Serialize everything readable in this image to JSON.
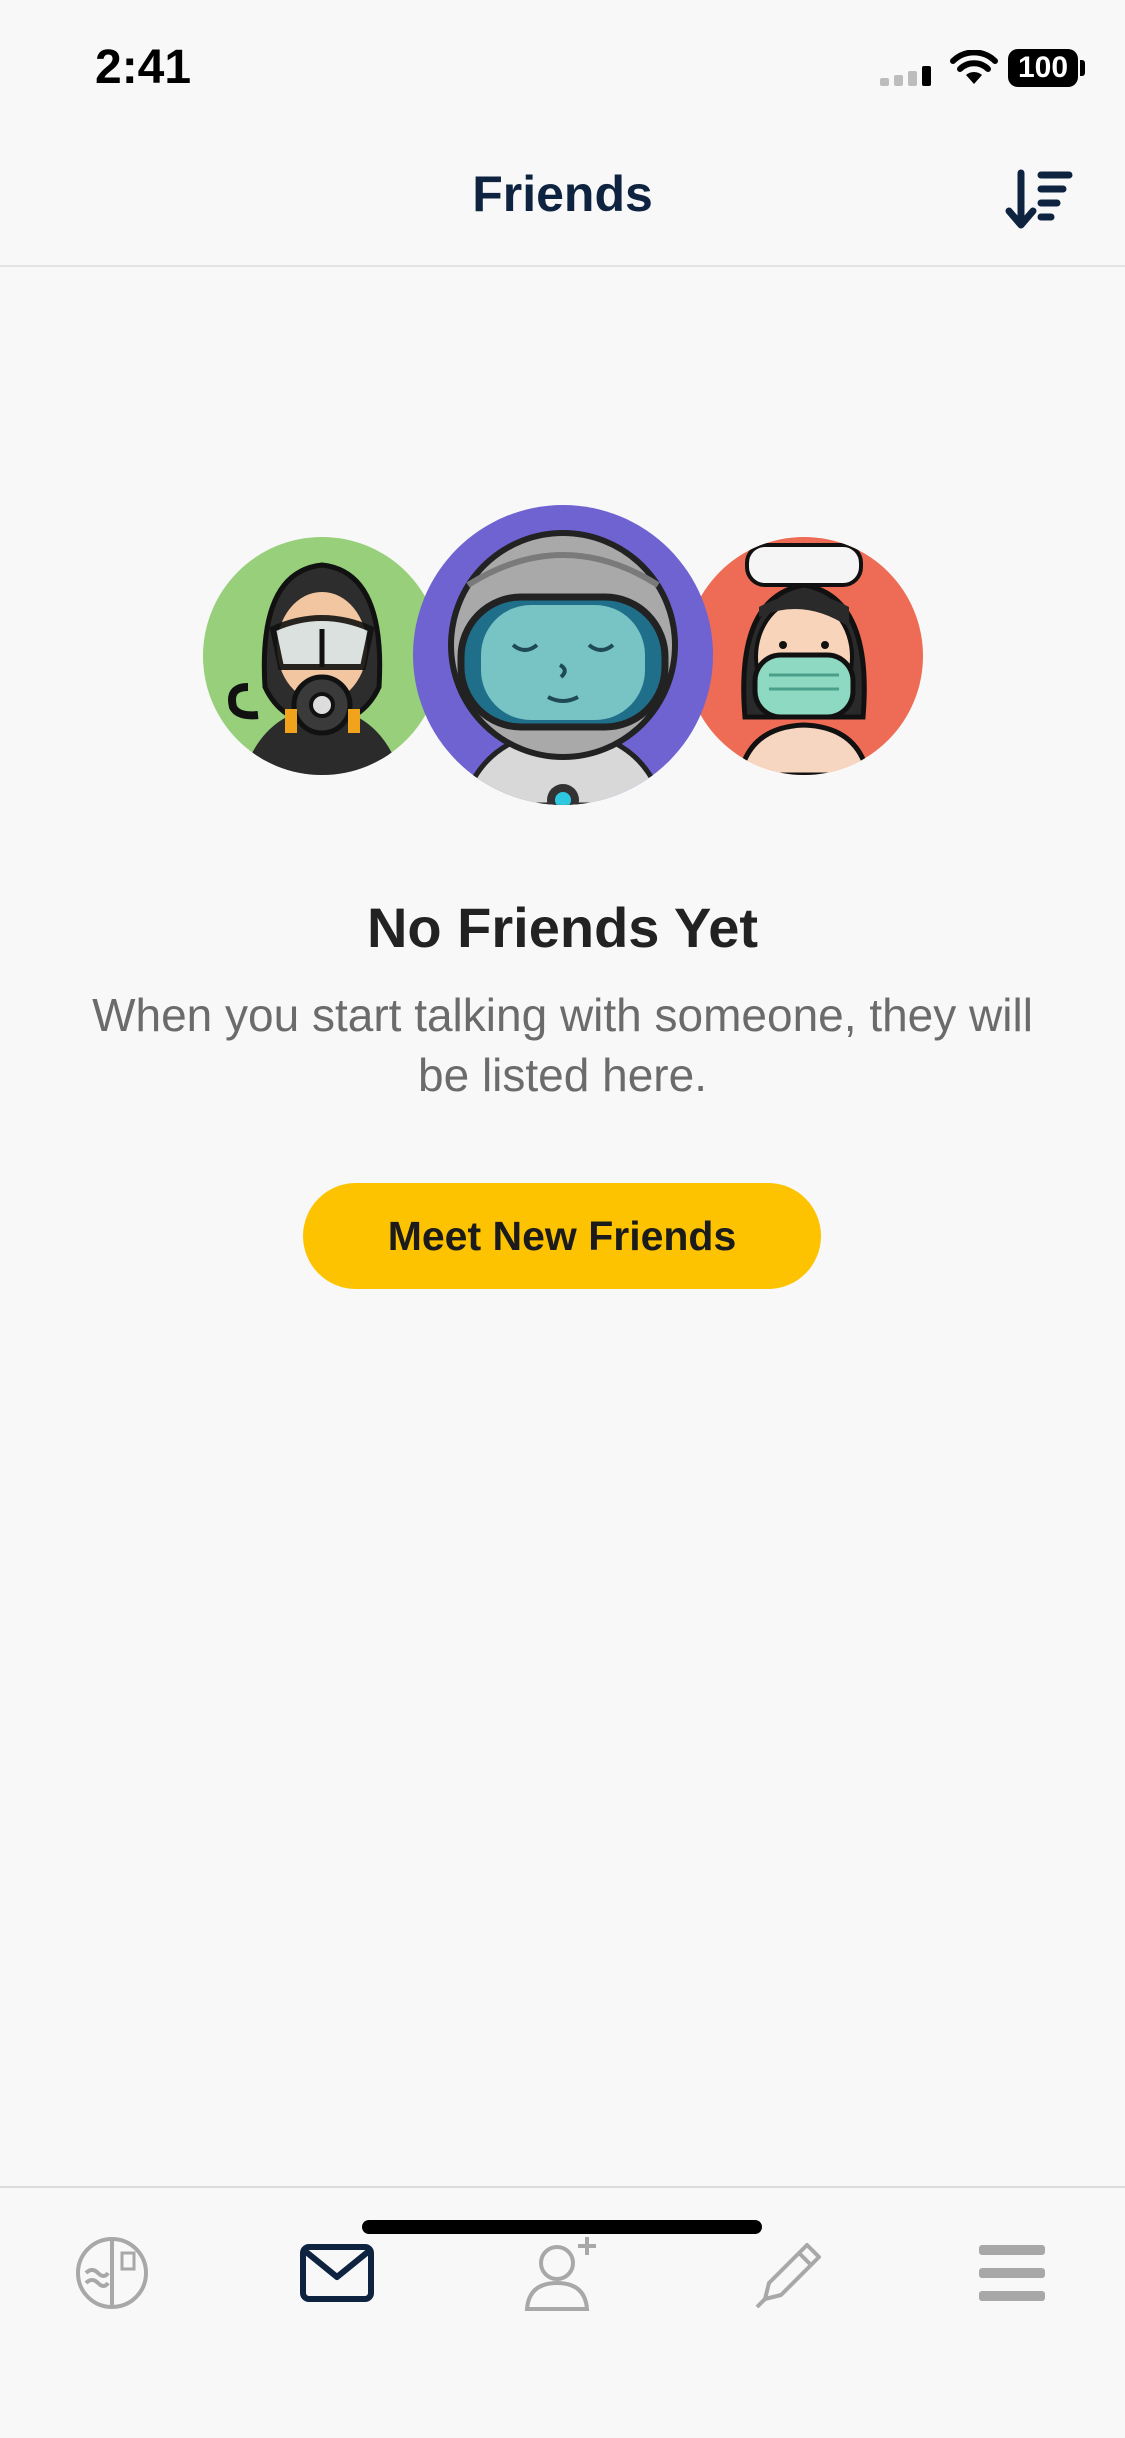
{
  "status": {
    "time": "2:41",
    "battery": "100"
  },
  "nav": {
    "title": "Friends",
    "sort_icon": "sort-descending-icon"
  },
  "empty_state": {
    "title": "No Friends Yet",
    "message": "When you start talking with someone, they will be listed here.",
    "button_label": "Meet New Friends",
    "avatar_colors": {
      "diver": "#98cf7a",
      "astronaut": "#6e63d1",
      "nurse": "#ee6c55"
    }
  },
  "tabs": [
    {
      "icon": "journal-icon",
      "active": false
    },
    {
      "icon": "envelope-icon",
      "active": true
    },
    {
      "icon": "add-person-icon",
      "active": false
    },
    {
      "icon": "pencil-icon",
      "active": false
    },
    {
      "icon": "menu-icon",
      "active": false
    }
  ],
  "colors": {
    "accent": "#fdc300",
    "nav_text": "#0e2340",
    "inactive_icon": "#a8a8a8"
  }
}
